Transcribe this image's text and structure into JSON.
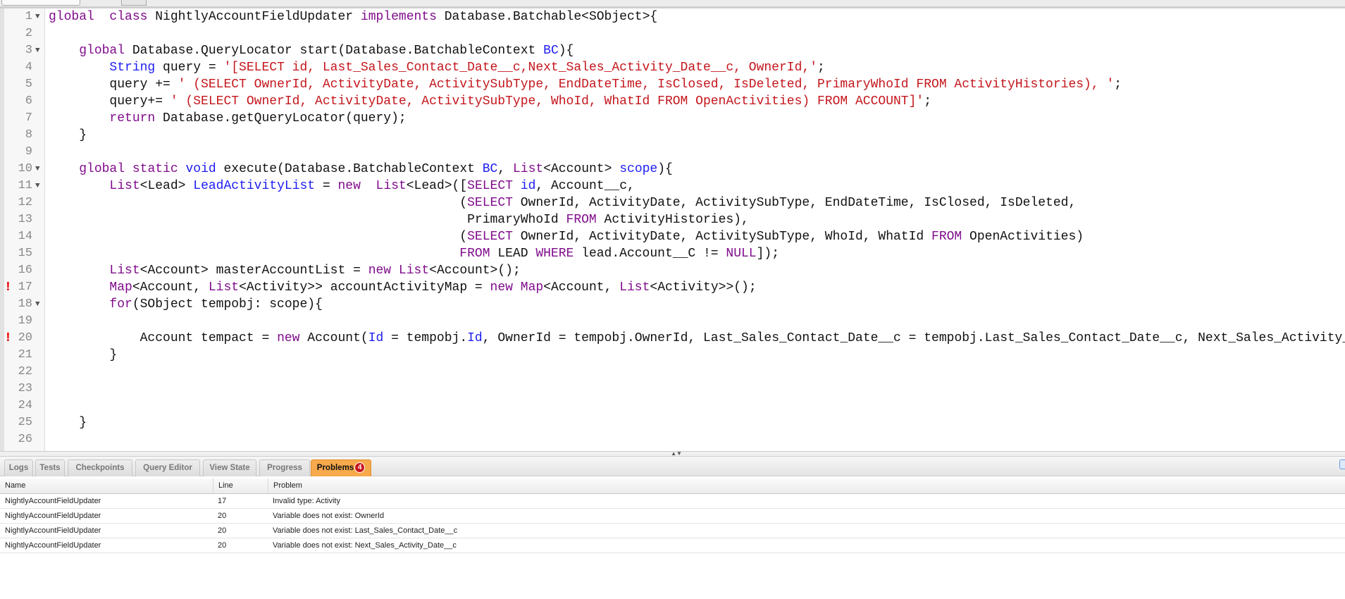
{
  "editor": {
    "lines": [
      {
        "n": "1",
        "fold": true,
        "tokens": [
          [
            "k",
            "global"
          ],
          [
            "",
            "  "
          ],
          [
            "k",
            "class"
          ],
          [
            "",
            " NightlyAccountFieldUpdater "
          ],
          [
            "k",
            "implements"
          ],
          [
            "",
            " Database.Batchable<SObject>{"
          ]
        ]
      },
      {
        "n": "2",
        "tokens": []
      },
      {
        "n": "3",
        "fold": true,
        "tokens": [
          [
            "",
            "    "
          ],
          [
            "k",
            "global"
          ],
          [
            "",
            " Database.QueryLocator start(Database.BatchableContext "
          ],
          [
            "t",
            "BC"
          ],
          [
            "",
            "){"
          ]
        ]
      },
      {
        "n": "4",
        "tokens": [
          [
            "",
            "        "
          ],
          [
            "t",
            "String"
          ],
          [
            "",
            " query = "
          ],
          [
            "s",
            "'[SELECT id, Last_Sales_Contact_Date__c,Next_Sales_Activity_Date__c, OwnerId,'"
          ],
          [
            "",
            ";"
          ]
        ]
      },
      {
        "n": "5",
        "tokens": [
          [
            "",
            "        query += "
          ],
          [
            "s",
            "' (SELECT OwnerId, ActivityDate, ActivitySubType, EndDateTime, IsClosed, IsDeleted, PrimaryWhoId FROM ActivityHistories), '"
          ],
          [
            "",
            ";"
          ]
        ]
      },
      {
        "n": "6",
        "tokens": [
          [
            "",
            "        query+= "
          ],
          [
            "s",
            "' (SELECT OwnerId, ActivityDate, ActivitySubType, WhoId, WhatId FROM OpenActivities) FROM ACCOUNT]'"
          ],
          [
            "",
            ";"
          ]
        ]
      },
      {
        "n": "7",
        "tokens": [
          [
            "",
            "        "
          ],
          [
            "k",
            "return"
          ],
          [
            "",
            " Database.getQueryLocator(query);"
          ]
        ]
      },
      {
        "n": "8",
        "tokens": [
          [
            "",
            "    }"
          ]
        ]
      },
      {
        "n": "9",
        "tokens": []
      },
      {
        "n": "10",
        "fold": true,
        "tokens": [
          [
            "",
            "    "
          ],
          [
            "k",
            "global"
          ],
          [
            "",
            " "
          ],
          [
            "k",
            "static"
          ],
          [
            "",
            " "
          ],
          [
            "t",
            "void"
          ],
          [
            "",
            " execute(Database.BatchableContext "
          ],
          [
            "t",
            "BC"
          ],
          [
            "",
            ", "
          ],
          [
            "k",
            "List"
          ],
          [
            "",
            "<Account> "
          ],
          [
            "t",
            "scope"
          ],
          [
            "",
            "){"
          ]
        ]
      },
      {
        "n": "11",
        "fold": true,
        "tokens": [
          [
            "",
            "        "
          ],
          [
            "k",
            "List"
          ],
          [
            "",
            "<Lead> "
          ],
          [
            "t",
            "LeadActivityList"
          ],
          [
            "",
            " = "
          ],
          [
            "k",
            "new"
          ],
          [
            "",
            "  "
          ],
          [
            "k",
            "List"
          ],
          [
            "",
            "<Lead>(["
          ],
          [
            "k",
            "SELECT"
          ],
          [
            "",
            " "
          ],
          [
            "t",
            "id"
          ],
          [
            "",
            ", Account__c,"
          ]
        ]
      },
      {
        "n": "12",
        "tokens": [
          [
            "",
            "                                                      ("
          ],
          [
            "k",
            "SELECT"
          ],
          [
            "",
            " OwnerId, ActivityDate, ActivitySubType, EndDateTime, IsClosed, IsDeleted,"
          ]
        ]
      },
      {
        "n": "13",
        "tokens": [
          [
            "",
            "                                                       PrimaryWhoId "
          ],
          [
            "k",
            "FROM"
          ],
          [
            "",
            " ActivityHistories),"
          ]
        ]
      },
      {
        "n": "14",
        "tokens": [
          [
            "",
            "                                                      ("
          ],
          [
            "k",
            "SELECT"
          ],
          [
            "",
            " OwnerId, ActivityDate, ActivitySubType, WhoId, WhatId "
          ],
          [
            "k",
            "FROM"
          ],
          [
            "",
            " OpenActivities)"
          ]
        ]
      },
      {
        "n": "15",
        "tokens": [
          [
            "",
            "                                                      "
          ],
          [
            "k",
            "FROM"
          ],
          [
            "",
            " LEAD "
          ],
          [
            "k",
            "WHERE"
          ],
          [
            "",
            " lead.Account__C != "
          ],
          [
            "k",
            "NULL"
          ],
          [
            "",
            "]);"
          ]
        ]
      },
      {
        "n": "16",
        "tokens": [
          [
            "",
            "        "
          ],
          [
            "k",
            "List"
          ],
          [
            "",
            "<Account> masterAccountList = "
          ],
          [
            "k",
            "new"
          ],
          [
            "",
            " "
          ],
          [
            "k",
            "List"
          ],
          [
            "",
            "<Account>();"
          ]
        ]
      },
      {
        "n": "17",
        "error": true,
        "tokens": [
          [
            "",
            "        "
          ],
          [
            "k",
            "Map"
          ],
          [
            "",
            "<Account, "
          ],
          [
            "k",
            "List"
          ],
          [
            "",
            "<Activity>> accountActivityMap = "
          ],
          [
            "k",
            "new"
          ],
          [
            "",
            " "
          ],
          [
            "k",
            "Map"
          ],
          [
            "",
            "<Account, "
          ],
          [
            "k",
            "List"
          ],
          [
            "",
            "<Activity>>();"
          ]
        ]
      },
      {
        "n": "18",
        "fold": true,
        "tokens": [
          [
            "",
            "        "
          ],
          [
            "k",
            "for"
          ],
          [
            "",
            "(SObject tempobj: scope){"
          ]
        ]
      },
      {
        "n": "19",
        "tokens": []
      },
      {
        "n": "20",
        "error": true,
        "tokens": [
          [
            "",
            "            Account tempact = "
          ],
          [
            "k",
            "new"
          ],
          [
            "",
            " Account("
          ],
          [
            "t",
            "Id"
          ],
          [
            "",
            " = tempobj."
          ],
          [
            "t",
            "Id"
          ],
          [
            "",
            ", OwnerId = tempobj.OwnerId, Last_Sales_Contact_Date__c = tempobj.Last_Sales_Contact_Date__c, Next_Sales_Activity_Date__c"
          ]
        ]
      },
      {
        "n": "21",
        "tokens": [
          [
            "",
            "        }"
          ]
        ]
      },
      {
        "n": "22",
        "tokens": []
      },
      {
        "n": "23",
        "tokens": []
      },
      {
        "n": "24",
        "tokens": []
      },
      {
        "n": "25",
        "tokens": [
          [
            "",
            "    }"
          ]
        ]
      },
      {
        "n": "26",
        "tokens": []
      }
    ],
    "error_marker": "!",
    "fold_icon": "▼"
  },
  "panel": {
    "tabs": [
      {
        "label": "Logs"
      },
      {
        "label": "Tests"
      },
      {
        "label": "Checkpoints"
      },
      {
        "label": "Query Editor"
      },
      {
        "label": "View State"
      },
      {
        "label": "Progress"
      },
      {
        "label": "Problems",
        "badge": "4",
        "active": true
      }
    ],
    "columns": {
      "name": "Name",
      "line": "Line",
      "problem": "Problem"
    },
    "problems": [
      {
        "name": "NightlyAccountFieldUpdater",
        "line": "17",
        "problem": "Invalid type: Activity"
      },
      {
        "name": "NightlyAccountFieldUpdater",
        "line": "20",
        "problem": "Variable does not exist: OwnerId"
      },
      {
        "name": "NightlyAccountFieldUpdater",
        "line": "20",
        "problem": "Variable does not exist: Last_Sales_Contact_Date__c"
      },
      {
        "name": "NightlyAccountFieldUpdater",
        "line": "20",
        "problem": "Variable does not exist: Next_Sales_Activity_Date__c"
      }
    ]
  },
  "colors": {
    "keyword": "#800c8c",
    "type": "#1d1df2",
    "string": "#c4161c",
    "active_tab": "#f7a94b",
    "badge": "#c8141b",
    "error": "#e00000"
  }
}
